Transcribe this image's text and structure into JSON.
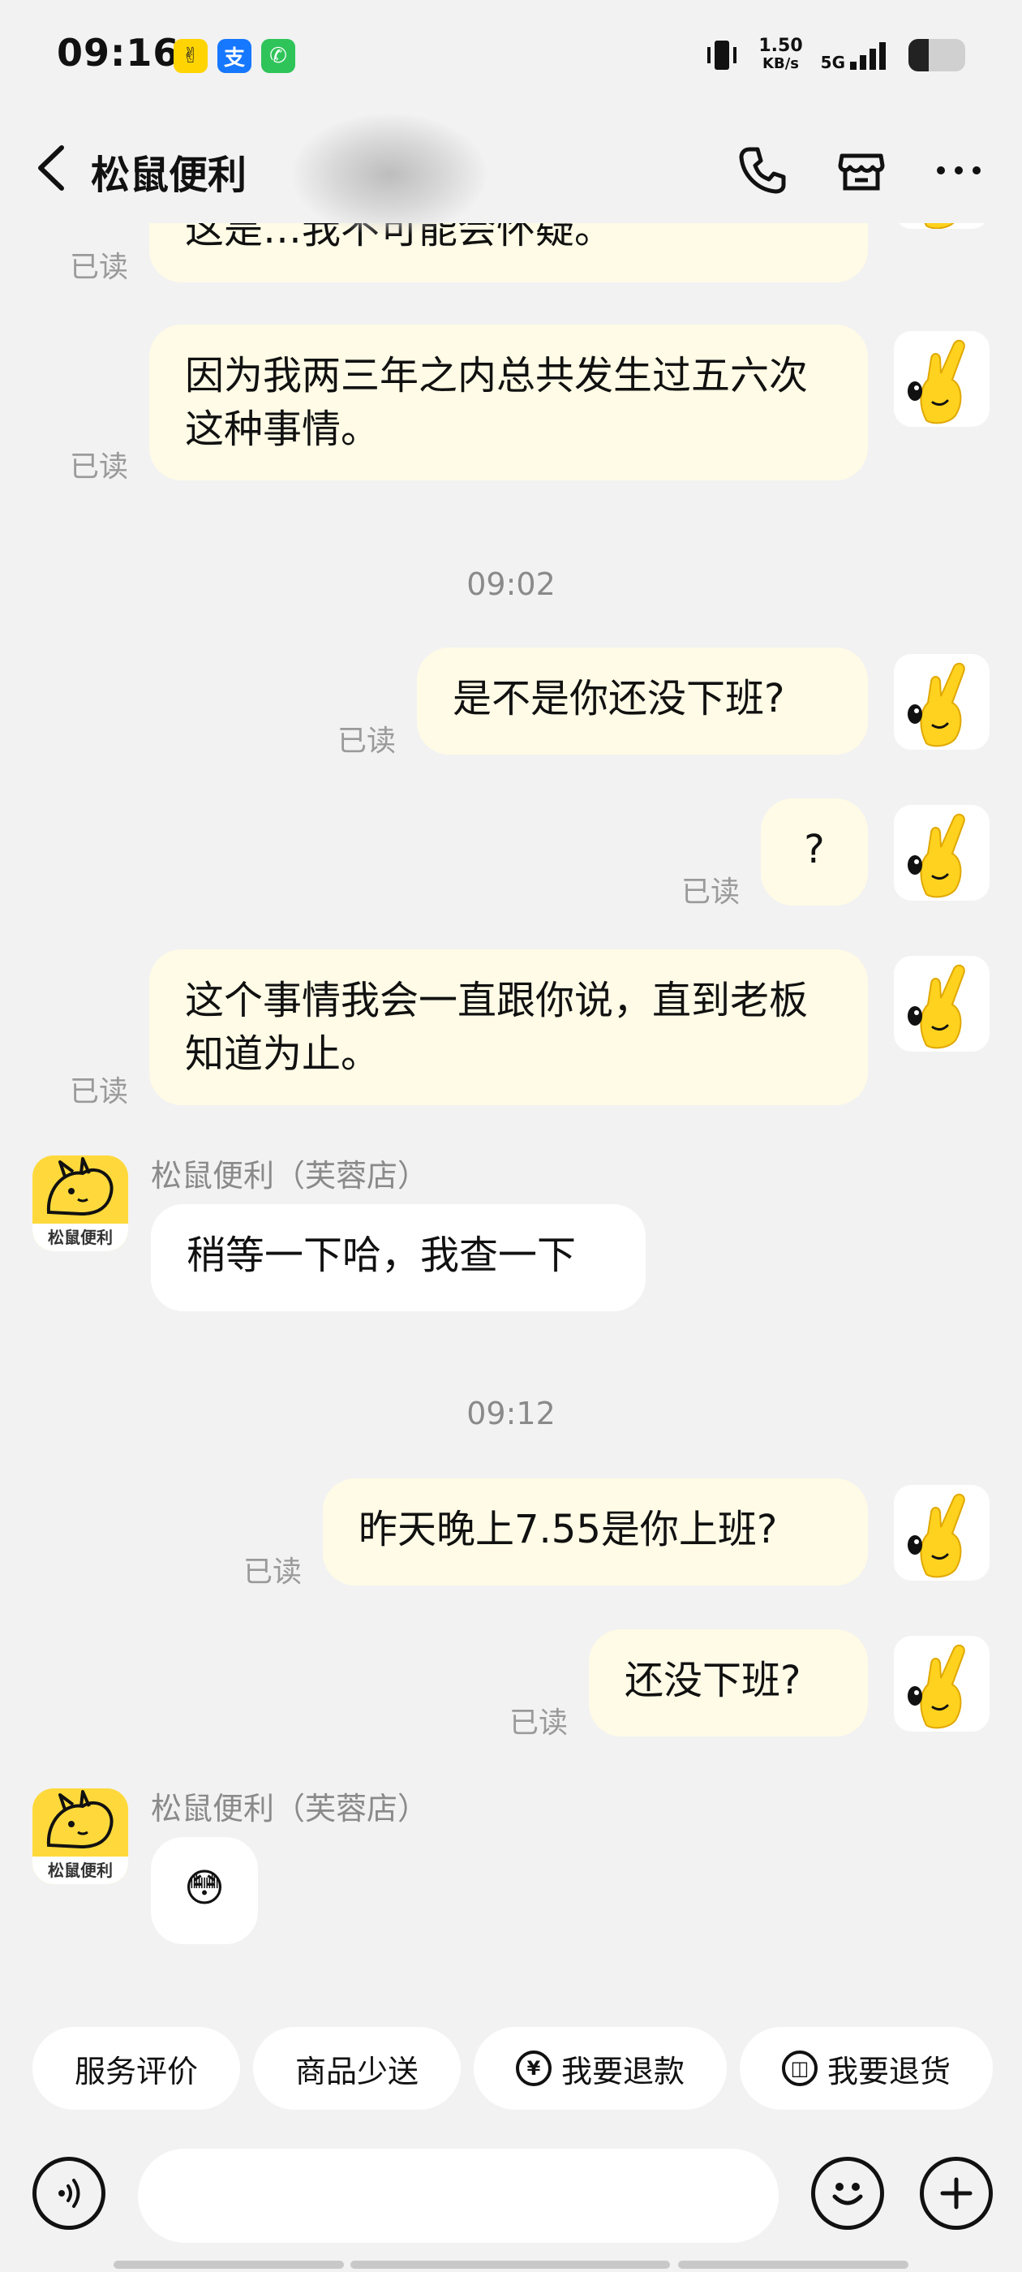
{
  "status_bar": {
    "time": "09:16",
    "speed_value": "1.50",
    "speed_unit": "KB/s",
    "network": "5G",
    "battery_level": 0.35
  },
  "header": {
    "title": "松鼠便利"
  },
  "messages": {
    "m0": {
      "text": "这是…我不可能会怀疑。",
      "read": "已读"
    },
    "m1": {
      "text": "因为我两三年之内总共发生过五六次这种事情。",
      "read": "已读"
    },
    "t1": "09:02",
    "m2": {
      "text": "是不是你还没下班?",
      "read": "已读"
    },
    "m3": {
      "text": "?",
      "read": "已读"
    },
    "m4": {
      "text": "这个事情我会一直跟你说，直到老板知道为止。",
      "read": "已读"
    },
    "s1": {
      "sender": "松鼠便利（芙蓉店）",
      "text": "稍等一下哈，我查一下"
    },
    "t2": "09:12",
    "m5": {
      "text": "昨天晚上7.55是你上班?",
      "read": "已读"
    },
    "m6": {
      "text": "还没下班?",
      "read": "已读"
    },
    "s2": {
      "sender": "松鼠便利（芙蓉店）",
      "emoji": "😳"
    }
  },
  "shop_avatar_label": "松鼠便利",
  "quick_replies": {
    "q1": "服务评价",
    "q2": "商品少送",
    "q3": "我要退款",
    "q4": "我要退货"
  },
  "icons": {
    "back": "chevron-left-icon",
    "phone": "phone-icon",
    "store": "store-icon",
    "more": "more-icon",
    "voice": "voice-icon",
    "emoji": "emoji-icon",
    "plus": "plus-icon"
  },
  "colors": {
    "my_bubble": "#fffbe6",
    "shop_bubble": "#ffffff",
    "background": "#f2f2f2",
    "brand_yellow": "#ffd93b"
  }
}
